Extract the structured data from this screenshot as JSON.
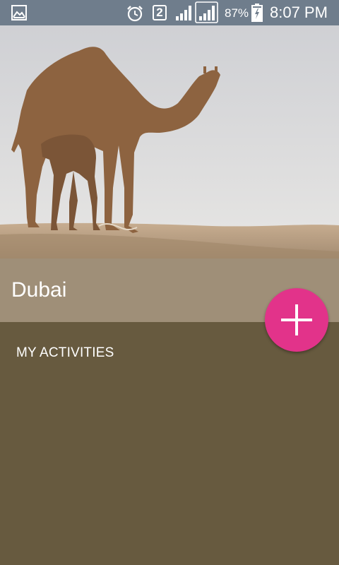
{
  "status_bar": {
    "icons": {
      "left": "gallery-icon",
      "alarm": "alarm-icon",
      "signal_1": "signal-icon",
      "signal_2": "signal-icon",
      "battery": "battery-charging-icon"
    },
    "sim_number": "2",
    "battery_percent": "87%",
    "time": "8:07 PM",
    "background_color": "#6f7d8c"
  },
  "header": {
    "image": "camel-and-calf-in-desert"
  },
  "title_band": {
    "title": "Dubai",
    "background_color": "#9f8f78"
  },
  "fab": {
    "icon": "plus-icon",
    "color": "#e2338a"
  },
  "content": {
    "section_label": "MY ACTIVITIES",
    "background_color": "#675a3f"
  }
}
